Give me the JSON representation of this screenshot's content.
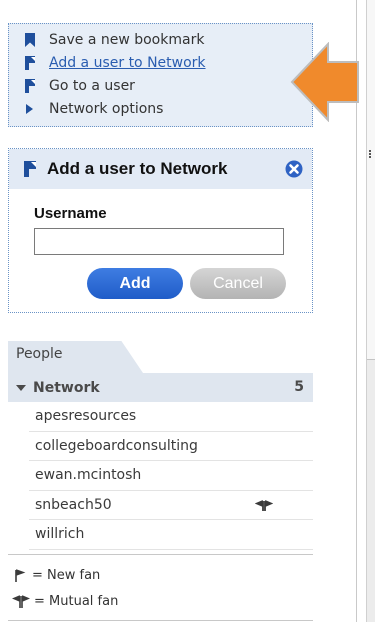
{
  "menu": {
    "items": [
      {
        "label": "Save a new bookmark",
        "icon": "bookmark-icon"
      },
      {
        "label": "Add a user to Network",
        "icon": "user-flag-icon"
      },
      {
        "label": "Go to a user",
        "icon": "user-flag-icon"
      },
      {
        "label": "Network options",
        "icon": "triangle-right-icon"
      }
    ]
  },
  "add_panel": {
    "title": "Add a user to Network",
    "username_label": "Username",
    "username_value": "",
    "add_label": "Add",
    "cancel_label": "Cancel"
  },
  "people": {
    "tab_label": "People",
    "network_label": "Network",
    "network_count": "5",
    "users": [
      {
        "name": "apesresources",
        "mutual": false
      },
      {
        "name": "collegeboardconsulting",
        "mutual": false
      },
      {
        "name": "ewan.mcintosh",
        "mutual": false
      },
      {
        "name": "snbeach50",
        "mutual": true
      },
      {
        "name": "willrich",
        "mutual": false
      }
    ]
  },
  "legend": {
    "new_fan": "= New fan",
    "mutual_fan": "= Mutual fan"
  },
  "colors": {
    "accent": "#2a5db0",
    "add_button": "#2f6fd8",
    "arrow": "#f08a2c",
    "panel_bg": "#e7eef7"
  }
}
